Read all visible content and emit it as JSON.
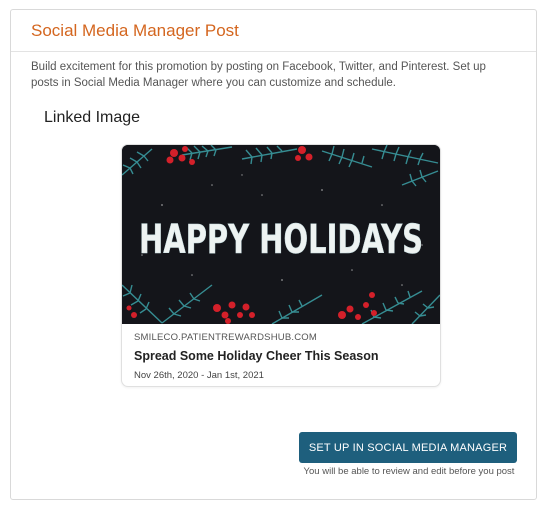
{
  "panel": {
    "title": "Social Media Manager Post",
    "description": "Build excitement for this promotion by posting on Facebook, Twitter, and Pinterest. Set up posts in Social Media Manager where you can customize and schedule."
  },
  "linked_image": {
    "label": "Linked Image",
    "card": {
      "image_text": "HAPPY HOLIDAYS",
      "domain": "SMILECO.PATIENTREWARDSHUB.COM",
      "headline": "Spread Some Holiday Cheer This Season",
      "dates": "Nov 26th, 2020 - Jan 1st, 2021"
    }
  },
  "actions": {
    "setup_button_label": "SET UP IN SOCIAL MEDIA MANAGER",
    "hint": "You will be able to review and edit before you post"
  },
  "colors": {
    "title_orange": "#d4661f",
    "button_blue": "#1e5f7d",
    "image_background": "#14151a",
    "pine_teal": "#3a9aa0",
    "berry_red": "#d4202a"
  }
}
